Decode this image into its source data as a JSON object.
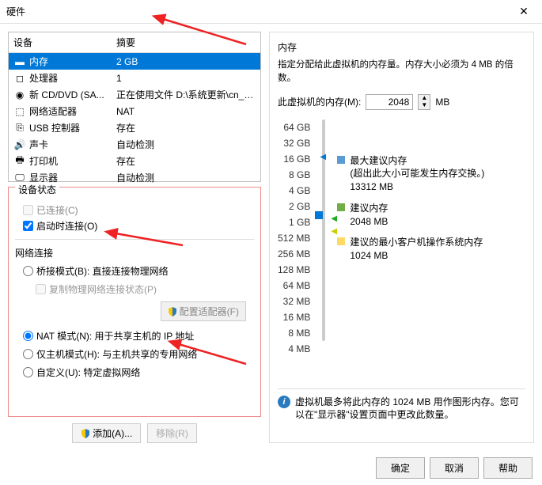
{
  "window": {
    "title": "硬件"
  },
  "device_table": {
    "col_device": "设备",
    "col_summary": "摘要",
    "rows": [
      {
        "icon": "memory",
        "name": "内存",
        "summary": "2 GB",
        "selected": true
      },
      {
        "icon": "cpu",
        "name": "处理器",
        "summary": "1"
      },
      {
        "icon": "cd",
        "name": "新 CD/DVD (SA...",
        "summary": "正在使用文件 D:\\系统更新\\cn_wi..."
      },
      {
        "icon": "net",
        "name": "网络适配器",
        "summary": "NAT"
      },
      {
        "icon": "usb",
        "name": "USB 控制器",
        "summary": "存在"
      },
      {
        "icon": "sound",
        "name": "声卡",
        "summary": "自动检测"
      },
      {
        "icon": "printer",
        "name": "打印机",
        "summary": "存在"
      },
      {
        "icon": "display",
        "name": "显示器",
        "summary": "自动检测"
      }
    ]
  },
  "status": {
    "title": "设备状态",
    "connected_label": "已连接(C)",
    "connect_on_start_label": "启动时连接(O)"
  },
  "network": {
    "title": "网络连接",
    "bridge_label": "桥接模式(B): 直接连接物理网络",
    "replicate_label": "复制物理网络连接状态(P)",
    "config_adapter_btn": "配置适配器(F)",
    "nat_label": "NAT 模式(N): 用于共享主机的 IP 地址",
    "hostonly_label": "仅主机模式(H): 与主机共享的专用网络",
    "custom_label": "自定义(U): 特定虚拟网络"
  },
  "buttons": {
    "add": "添加(A)...",
    "remove": "移除(R)"
  },
  "memory": {
    "title": "内存",
    "desc": "指定分配给此虚拟机的内存量。内存大小必须为 4 MB 的倍数。",
    "label": "此虚拟机的内存(M):",
    "value": "2048",
    "unit": "MB",
    "ticks": [
      "64 GB",
      "32 GB",
      "16 GB",
      "8 GB",
      "4 GB",
      "2 GB",
      "1 GB",
      "512 MB",
      "256 MB",
      "128 MB",
      "64 MB",
      "32 MB",
      "16 MB",
      "8 MB",
      "4 MB"
    ],
    "legend_max_title": "最大建议内存",
    "legend_max_desc": "(超出此大小可能发生内存交换。)",
    "legend_max_val": "13312 MB",
    "legend_rec_title": "建议内存",
    "legend_rec_val": "2048 MB",
    "legend_min_title": "建议的最小客户机操作系统内存",
    "legend_min_val": "1024 MB",
    "note": "虚拟机最多将此内存的 1024 MB 用作图形内存。您可以在\"显示器\"设置页面中更改此数量。"
  },
  "bottom": {
    "ok": "确定",
    "cancel": "取消",
    "help": "帮助"
  }
}
